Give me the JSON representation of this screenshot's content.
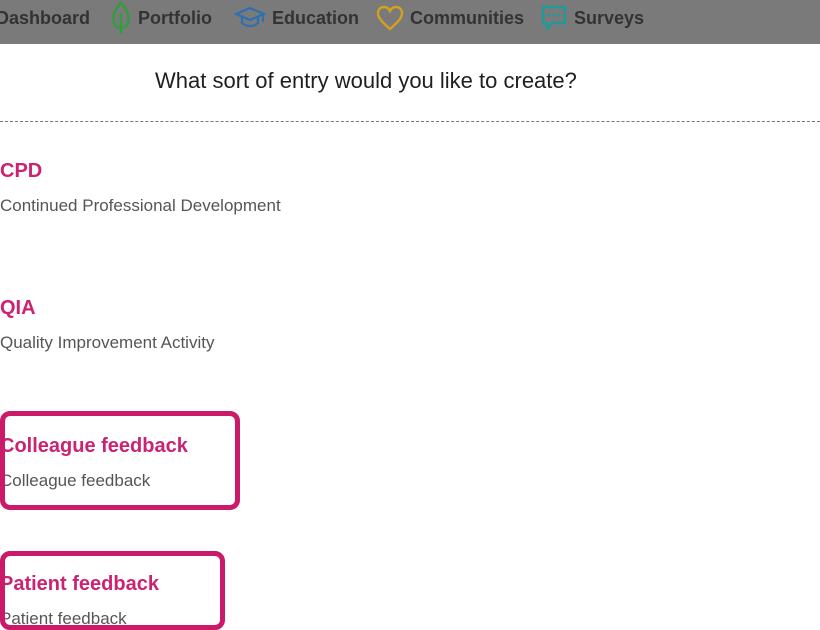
{
  "nav": {
    "items": [
      {
        "label": "Dashboard",
        "icon": "dashboard-icon"
      },
      {
        "label": "Portfolio",
        "icon": "leaf-icon",
        "color": "#2e9e3e"
      },
      {
        "label": "Education",
        "icon": "graduation-cap-icon",
        "color": "#2f6fb0"
      },
      {
        "label": "Communities",
        "icon": "heart-icon",
        "color": "#d4a020"
      },
      {
        "label": "Surveys",
        "icon": "chat-bubble-icon",
        "color": "#1f9a9a"
      }
    ]
  },
  "modal": {
    "title": "What sort of entry would you like to create?",
    "entries": [
      {
        "title": "CPD",
        "description": "Continued Professional Development"
      },
      {
        "title": "QIA",
        "description": "Quality Improvement Activity"
      },
      {
        "title": "Colleague feedback",
        "description": "Colleague feedback"
      },
      {
        "title": "Patient feedback",
        "description": "Patient feedback"
      }
    ]
  },
  "colors": {
    "accent": "#cc2272",
    "highlight": "#cc1a6a",
    "nav_background": "#7a7a7a"
  }
}
